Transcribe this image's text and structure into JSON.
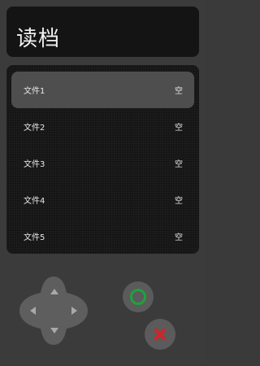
{
  "header": {
    "title": "读档"
  },
  "save_slots": [
    {
      "label": "文件1",
      "state": "空",
      "selected": true
    },
    {
      "label": "文件2",
      "state": "空",
      "selected": false
    },
    {
      "label": "文件3",
      "state": "空",
      "selected": false
    },
    {
      "label": "文件4",
      "state": "空",
      "selected": false
    },
    {
      "label": "文件5",
      "state": "空",
      "selected": false
    }
  ],
  "controls": {
    "dpad": {
      "icons": [
        "arrow-up-icon",
        "arrow-down-icon",
        "arrow-left-icon",
        "arrow-right-icon"
      ]
    },
    "confirm_button": {
      "icon": "circle-icon",
      "color": "#1fa23c"
    },
    "cancel_button": {
      "icon": "cross-icon",
      "color": "#d0242b"
    }
  },
  "colors": {
    "background": "#3b3b3b",
    "panel": "#141414",
    "selected_row": "#4e4e4e",
    "text": "#e6e6e6"
  }
}
